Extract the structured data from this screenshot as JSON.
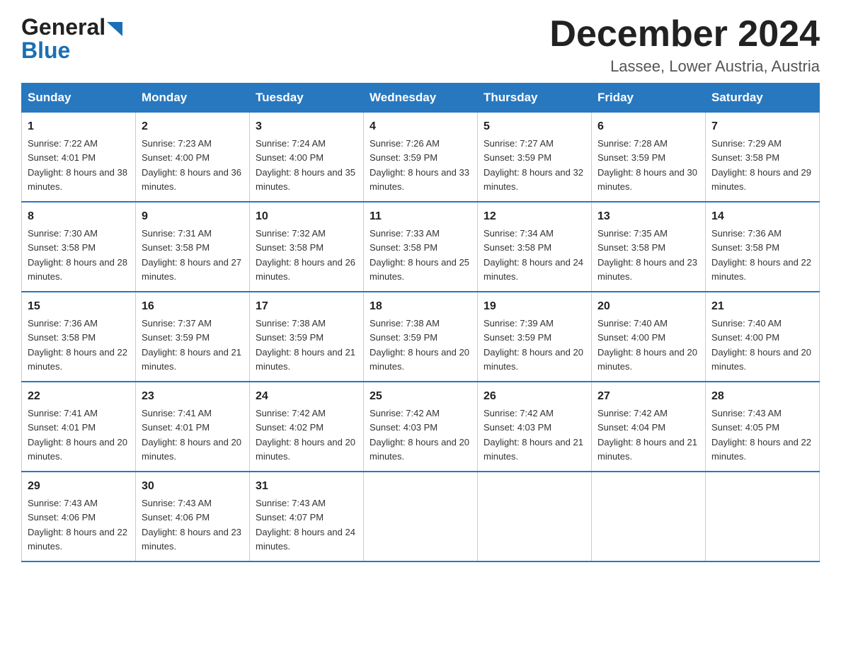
{
  "header": {
    "logo_general": "General",
    "logo_blue": "Blue",
    "month_title": "December 2024",
    "location": "Lassee, Lower Austria, Austria"
  },
  "weekdays": [
    "Sunday",
    "Monday",
    "Tuesday",
    "Wednesday",
    "Thursday",
    "Friday",
    "Saturday"
  ],
  "weeks": [
    [
      {
        "day": "1",
        "sunrise": "7:22 AM",
        "sunset": "4:01 PM",
        "daylight": "8 hours and 38 minutes."
      },
      {
        "day": "2",
        "sunrise": "7:23 AM",
        "sunset": "4:00 PM",
        "daylight": "8 hours and 36 minutes."
      },
      {
        "day": "3",
        "sunrise": "7:24 AM",
        "sunset": "4:00 PM",
        "daylight": "8 hours and 35 minutes."
      },
      {
        "day": "4",
        "sunrise": "7:26 AM",
        "sunset": "3:59 PM",
        "daylight": "8 hours and 33 minutes."
      },
      {
        "day": "5",
        "sunrise": "7:27 AM",
        "sunset": "3:59 PM",
        "daylight": "8 hours and 32 minutes."
      },
      {
        "day": "6",
        "sunrise": "7:28 AM",
        "sunset": "3:59 PM",
        "daylight": "8 hours and 30 minutes."
      },
      {
        "day": "7",
        "sunrise": "7:29 AM",
        "sunset": "3:58 PM",
        "daylight": "8 hours and 29 minutes."
      }
    ],
    [
      {
        "day": "8",
        "sunrise": "7:30 AM",
        "sunset": "3:58 PM",
        "daylight": "8 hours and 28 minutes."
      },
      {
        "day": "9",
        "sunrise": "7:31 AM",
        "sunset": "3:58 PM",
        "daylight": "8 hours and 27 minutes."
      },
      {
        "day": "10",
        "sunrise": "7:32 AM",
        "sunset": "3:58 PM",
        "daylight": "8 hours and 26 minutes."
      },
      {
        "day": "11",
        "sunrise": "7:33 AM",
        "sunset": "3:58 PM",
        "daylight": "8 hours and 25 minutes."
      },
      {
        "day": "12",
        "sunrise": "7:34 AM",
        "sunset": "3:58 PM",
        "daylight": "8 hours and 24 minutes."
      },
      {
        "day": "13",
        "sunrise": "7:35 AM",
        "sunset": "3:58 PM",
        "daylight": "8 hours and 23 minutes."
      },
      {
        "day": "14",
        "sunrise": "7:36 AM",
        "sunset": "3:58 PM",
        "daylight": "8 hours and 22 minutes."
      }
    ],
    [
      {
        "day": "15",
        "sunrise": "7:36 AM",
        "sunset": "3:58 PM",
        "daylight": "8 hours and 22 minutes."
      },
      {
        "day": "16",
        "sunrise": "7:37 AM",
        "sunset": "3:59 PM",
        "daylight": "8 hours and 21 minutes."
      },
      {
        "day": "17",
        "sunrise": "7:38 AM",
        "sunset": "3:59 PM",
        "daylight": "8 hours and 21 minutes."
      },
      {
        "day": "18",
        "sunrise": "7:38 AM",
        "sunset": "3:59 PM",
        "daylight": "8 hours and 20 minutes."
      },
      {
        "day": "19",
        "sunrise": "7:39 AM",
        "sunset": "3:59 PM",
        "daylight": "8 hours and 20 minutes."
      },
      {
        "day": "20",
        "sunrise": "7:40 AM",
        "sunset": "4:00 PM",
        "daylight": "8 hours and 20 minutes."
      },
      {
        "day": "21",
        "sunrise": "7:40 AM",
        "sunset": "4:00 PM",
        "daylight": "8 hours and 20 minutes."
      }
    ],
    [
      {
        "day": "22",
        "sunrise": "7:41 AM",
        "sunset": "4:01 PM",
        "daylight": "8 hours and 20 minutes."
      },
      {
        "day": "23",
        "sunrise": "7:41 AM",
        "sunset": "4:01 PM",
        "daylight": "8 hours and 20 minutes."
      },
      {
        "day": "24",
        "sunrise": "7:42 AM",
        "sunset": "4:02 PM",
        "daylight": "8 hours and 20 minutes."
      },
      {
        "day": "25",
        "sunrise": "7:42 AM",
        "sunset": "4:03 PM",
        "daylight": "8 hours and 20 minutes."
      },
      {
        "day": "26",
        "sunrise": "7:42 AM",
        "sunset": "4:03 PM",
        "daylight": "8 hours and 21 minutes."
      },
      {
        "day": "27",
        "sunrise": "7:42 AM",
        "sunset": "4:04 PM",
        "daylight": "8 hours and 21 minutes."
      },
      {
        "day": "28",
        "sunrise": "7:43 AM",
        "sunset": "4:05 PM",
        "daylight": "8 hours and 22 minutes."
      }
    ],
    [
      {
        "day": "29",
        "sunrise": "7:43 AM",
        "sunset": "4:06 PM",
        "daylight": "8 hours and 22 minutes."
      },
      {
        "day": "30",
        "sunrise": "7:43 AM",
        "sunset": "4:06 PM",
        "daylight": "8 hours and 23 minutes."
      },
      {
        "day": "31",
        "sunrise": "7:43 AM",
        "sunset": "4:07 PM",
        "daylight": "8 hours and 24 minutes."
      },
      null,
      null,
      null,
      null
    ]
  ],
  "labels": {
    "sunrise_prefix": "Sunrise: ",
    "sunset_prefix": "Sunset: ",
    "daylight_prefix": "Daylight: "
  }
}
